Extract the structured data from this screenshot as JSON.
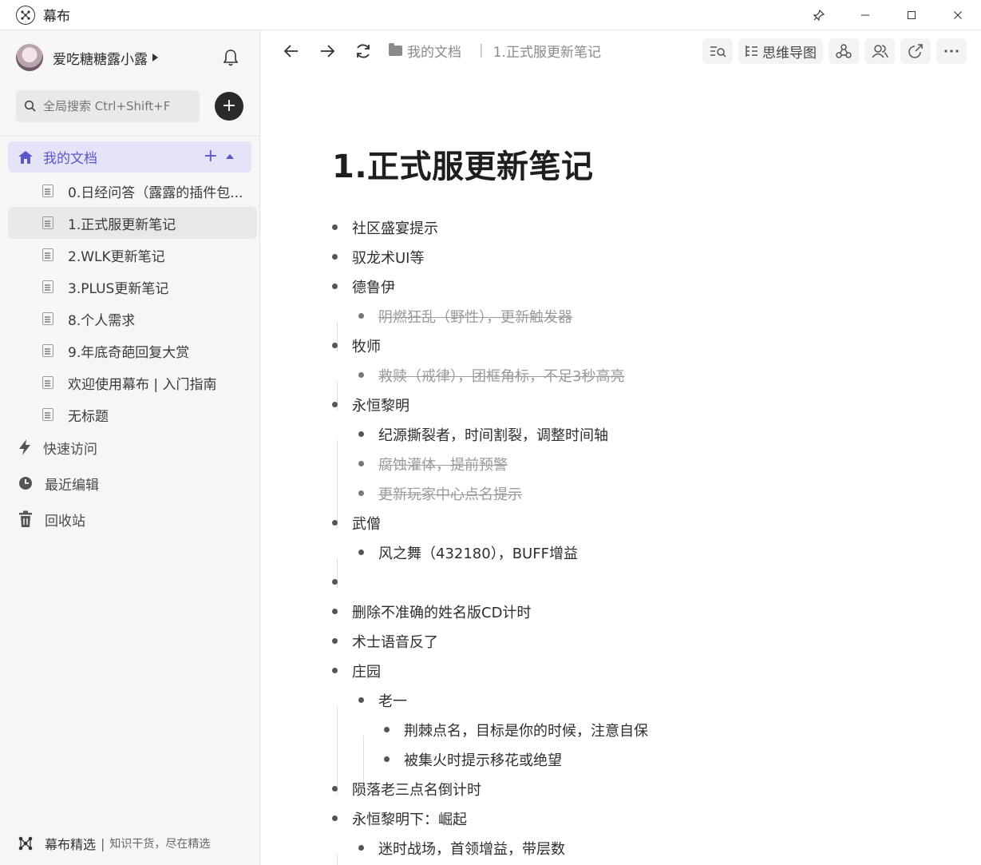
{
  "window": {
    "title": "幕布",
    "controls": [
      "pin",
      "minimize",
      "maximize",
      "close"
    ]
  },
  "sidebar": {
    "user_name": "爱吃糖糖露小露",
    "search_placeholder": "全局搜索 Ctrl+Shift+F",
    "my_docs_label": "我的文档",
    "docs": [
      {
        "label": "0.日经问答（露露的插件包...",
        "active": false
      },
      {
        "label": "1.正式服更新笔记",
        "active": true
      },
      {
        "label": "2.WLK更新笔记",
        "active": false
      },
      {
        "label": "3.PLUS更新笔记",
        "active": false
      },
      {
        "label": "8.个人需求",
        "active": false
      },
      {
        "label": "9.年底奇葩回复大赏",
        "active": false
      },
      {
        "label": "欢迎使用幕布 | 入门指南",
        "active": false
      },
      {
        "label": "无标题",
        "active": false
      }
    ],
    "nav": {
      "quick_access": "快速访问",
      "recent_edits": "最近编辑",
      "trash": "回收站"
    },
    "footer": {
      "brand": "幕布精选",
      "separator": "|",
      "slogan": "知识干货，尽在精选"
    }
  },
  "toolbar": {
    "breadcrumb_root": "我的文档",
    "breadcrumb_separator": "|",
    "breadcrumb_current": "1.正式服更新笔记",
    "mindmap_label": "思维导图"
  },
  "document": {
    "title": "1.正式服更新笔记",
    "outline": [
      {
        "text": "社区盛宴提示",
        "level": 0,
        "done": false
      },
      {
        "text": "驭龙术UI等",
        "level": 0,
        "done": false
      },
      {
        "text": "德鲁伊",
        "level": 0,
        "done": false
      },
      {
        "text": "阴燃狂乱（野性），更新触发器",
        "level": 1,
        "done": true
      },
      {
        "text": "牧师",
        "level": 0,
        "done": false
      },
      {
        "text": "救赎（戒律），团框角标，不足3秒高亮",
        "level": 1,
        "done": true
      },
      {
        "text": "永恒黎明",
        "level": 0,
        "done": false
      },
      {
        "text": "纪源撕裂者，时间割裂，调整时间轴",
        "level": 1,
        "done": false
      },
      {
        "text": "腐蚀灌体，提前预警",
        "level": 1,
        "done": true
      },
      {
        "text": "更新玩家中心点名提示",
        "level": 1,
        "done": true
      },
      {
        "text": "武僧",
        "level": 0,
        "done": false
      },
      {
        "text": "风之舞（432180），BUFF增益",
        "level": 1,
        "done": false
      },
      {
        "text": "",
        "level": 0,
        "done": false
      },
      {
        "text": "删除不准确的姓名版CD计时",
        "level": 0,
        "done": false
      },
      {
        "text": "术士语音反了",
        "level": 0,
        "done": false
      },
      {
        "text": "庄园",
        "level": 0,
        "done": false
      },
      {
        "text": "老一",
        "level": 1,
        "done": false
      },
      {
        "text": "荆棘点名，目标是你的时候，注意自保",
        "level": 2,
        "done": false
      },
      {
        "text": "被集火时提示移花或绝望",
        "level": 2,
        "done": false
      },
      {
        "text": "陨落老三点名倒计时",
        "level": 0,
        "done": false
      },
      {
        "text": "永恒黎明下：崛起",
        "level": 0,
        "done": false
      },
      {
        "text": "迷时战场，首领增益，带层数",
        "level": 1,
        "done": false
      }
    ]
  },
  "colors": {
    "accent": "#5b56c9",
    "accent_bg": "#e4e3f8",
    "sidebar_bg": "#f6f6f6",
    "done_text": "#9a9a9a"
  }
}
